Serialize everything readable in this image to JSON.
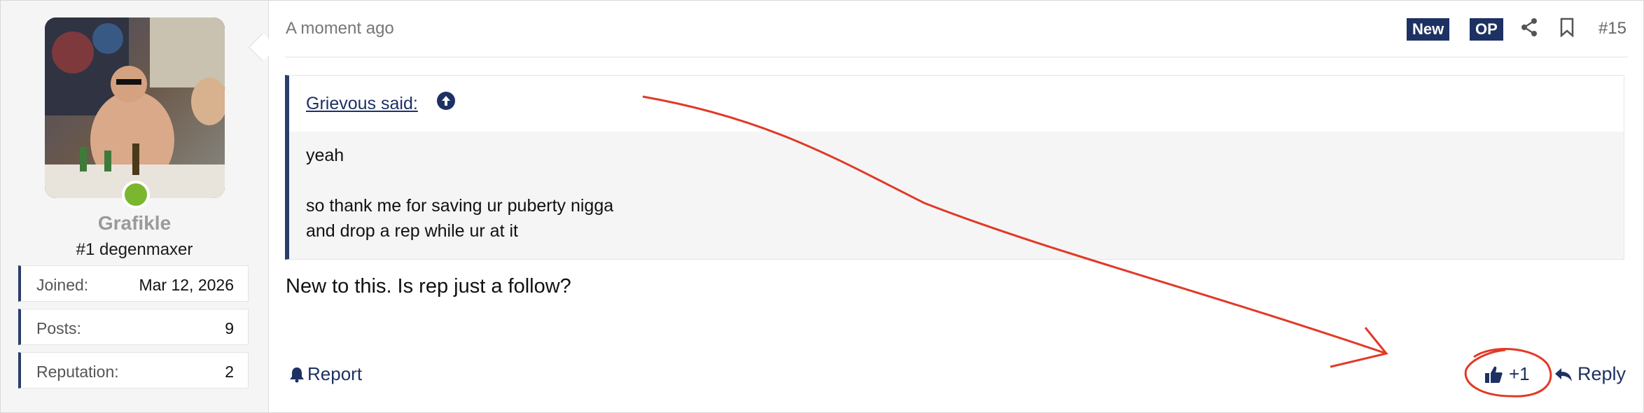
{
  "user": {
    "name": "Grafikle",
    "title": "#1 degenmaxer",
    "stats": [
      {
        "label": "Joined:",
        "value": "Mar 12, 2026"
      },
      {
        "label": "Posts:",
        "value": "9"
      },
      {
        "label": "Reputation:",
        "value": "2"
      }
    ],
    "online_color": "#7bb62f"
  },
  "post": {
    "timestamp": "A moment ago",
    "badges": {
      "new": "New",
      "op": "OP"
    },
    "number": "#15",
    "quote": {
      "author_label": "Grievous said:",
      "lines": [
        "yeah",
        "so thank me for saving ur puberty nigga",
        "and drop a rep while ur at it"
      ]
    },
    "message": "New to this. Is rep just a follow?",
    "actions": {
      "report": "Report",
      "like": "+1",
      "reply": "Reply"
    }
  },
  "icons": [
    "share-icon",
    "bookmark-icon",
    "arrow-up-circle-icon",
    "bell-icon",
    "thumbs-up-icon",
    "reply-icon"
  ],
  "colors": {
    "accent": "#1d3163",
    "annotation": "#e03a26"
  }
}
